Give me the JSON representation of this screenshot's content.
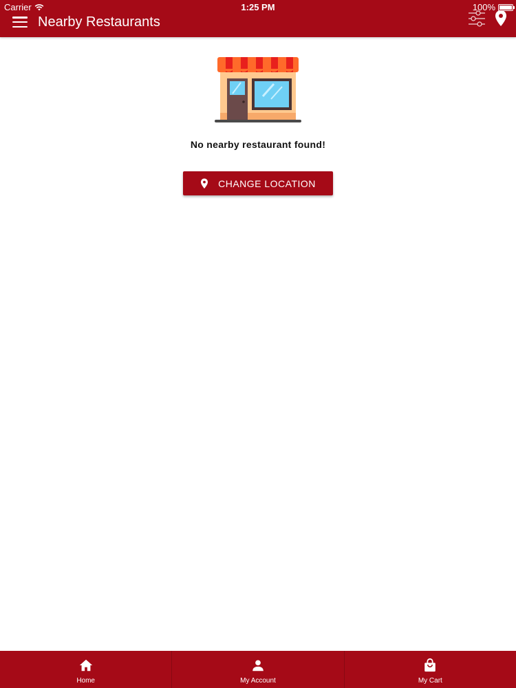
{
  "status_bar": {
    "carrier": "Carrier",
    "time": "1:25 PM",
    "battery": "100%"
  },
  "header": {
    "title": "Nearby Restaurants",
    "filter_icon": "sliders-icon",
    "location_icon": "map-pin-icon",
    "menu_icon": "hamburger-menu-icon"
  },
  "empty_state": {
    "illustration": "storefront-icon",
    "message": "No nearby restaurant found!",
    "button_label": "CHANGE LOCATION",
    "button_icon": "map-pin-icon"
  },
  "bottom_nav": {
    "items": [
      {
        "label": "Home",
        "icon": "home-icon"
      },
      {
        "label": "My Account",
        "icon": "person-icon"
      },
      {
        "label": "My Cart",
        "icon": "shopping-bag-icon"
      }
    ]
  },
  "colors": {
    "primary": "#a50a17",
    "background": "#ffffff",
    "text": "#111111",
    "awning_red": "#e8201d",
    "awning_orange": "#ff6a2a",
    "store_wall": "#ffc98f",
    "store_glass": "#6fd0f5",
    "store_door": "#6b4a4a"
  }
}
